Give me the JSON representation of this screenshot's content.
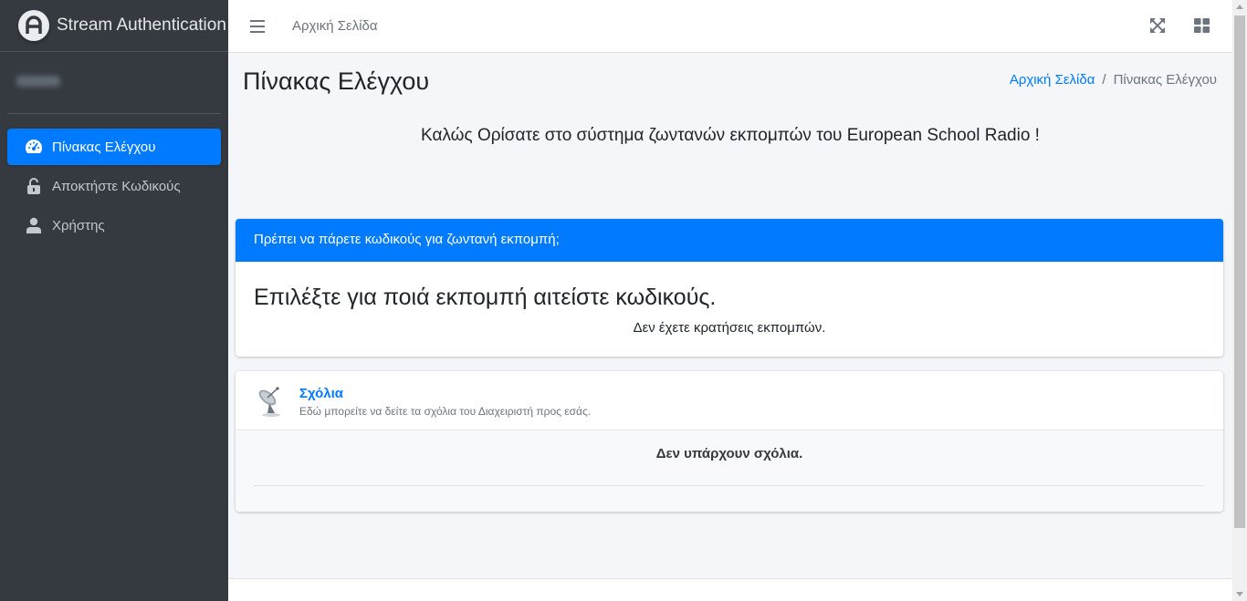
{
  "brand": {
    "title": "Stream Authentication"
  },
  "sidebar": {
    "items": [
      {
        "label": "Πίνακας Ελέγχου",
        "icon": "tachometer-icon",
        "active": true
      },
      {
        "label": "Αποκτήστε Κωδικούς",
        "icon": "lock-icon",
        "active": false
      },
      {
        "label": "Χρήστης",
        "icon": "user-icon",
        "active": false
      }
    ]
  },
  "topbar": {
    "home_label": "Αρχική Σελίδα"
  },
  "page": {
    "title": "Πίνακας Ελέγχου",
    "breadcrumb": {
      "home": "Αρχική Σελίδα",
      "separator": "/",
      "current": "Πίνακας Ελέγχου"
    },
    "welcome": "Καλώς Ορίσατε στο σύστημα ζωντανών εκπομπών του European School Radio !"
  },
  "codes_card": {
    "header": "Πρέπει να πάρετε κωδικούς για ζωντανή εκπομπή;",
    "title": "Επιλέξτε για ποιά εκπομπή αιτείστε κωδικούς.",
    "empty_text": "Δεν έχετε κρατήσεις εκπομπών."
  },
  "comments_card": {
    "title": "Σχόλια",
    "description": "Εδώ μπορείτε να δείτε τα σχόλια του Διαχειριστή προς εσάς.",
    "empty_text": "Δεν υπάρχουν σχόλια."
  },
  "colors": {
    "sidebar_bg": "#343a40",
    "primary": "#007bff",
    "content_bg": "#f4f6f9"
  }
}
